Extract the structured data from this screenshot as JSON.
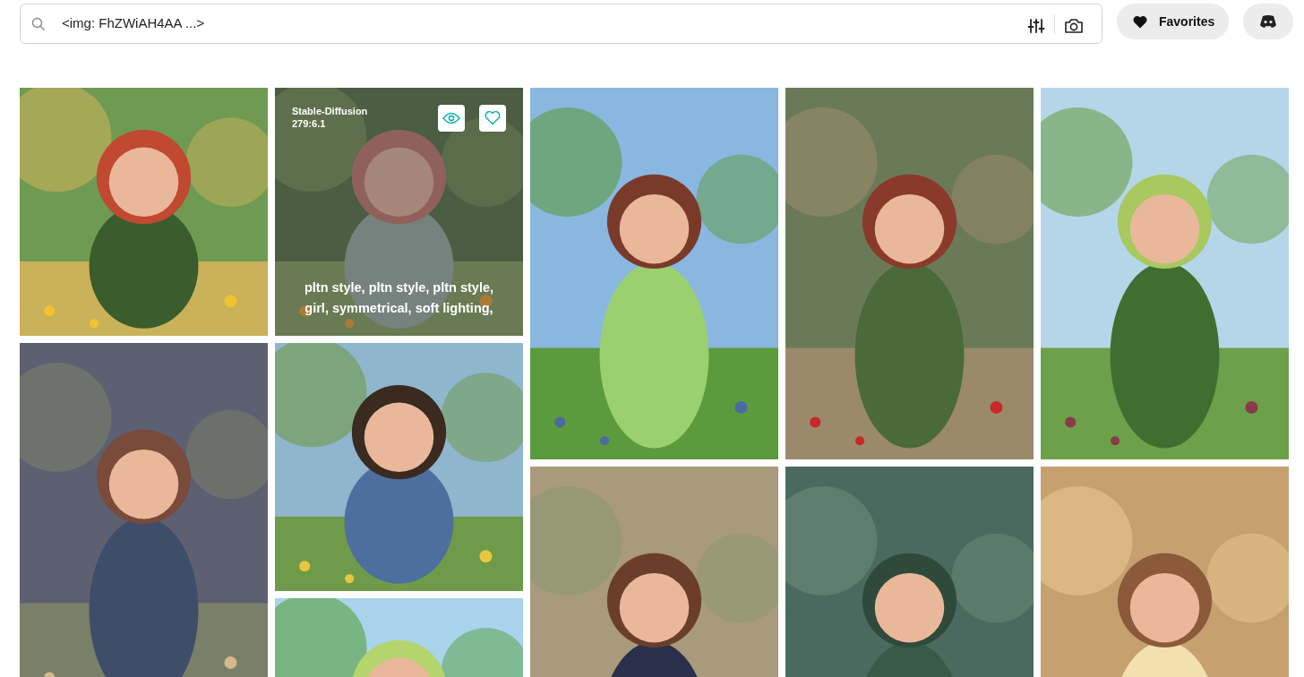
{
  "search": {
    "value": "<img: FhZWiAH4AA ...>"
  },
  "favorites_button": {
    "label": "Favorites"
  },
  "columns": [
    {
      "tiles": [
        {
          "kind": "square"
        },
        {
          "kind": "tall"
        }
      ]
    },
    {
      "tiles": [
        {
          "kind": "square",
          "overlay": {
            "model": "Stable-Diffusion",
            "ratio": "279:6.1",
            "prompt": "pltn style, pltn style, pltn style, girl, symmetrical, soft lighting,"
          }
        },
        {
          "kind": "square"
        },
        {
          "kind": "square"
        }
      ]
    },
    {
      "tiles": [
        {
          "kind": "tall"
        },
        {
          "kind": "tall"
        }
      ]
    },
    {
      "tiles": [
        {
          "kind": "tall"
        },
        {
          "kind": "tall"
        }
      ]
    },
    {
      "tiles": [
        {
          "kind": "tall"
        },
        {
          "kind": "tall"
        }
      ]
    }
  ]
}
